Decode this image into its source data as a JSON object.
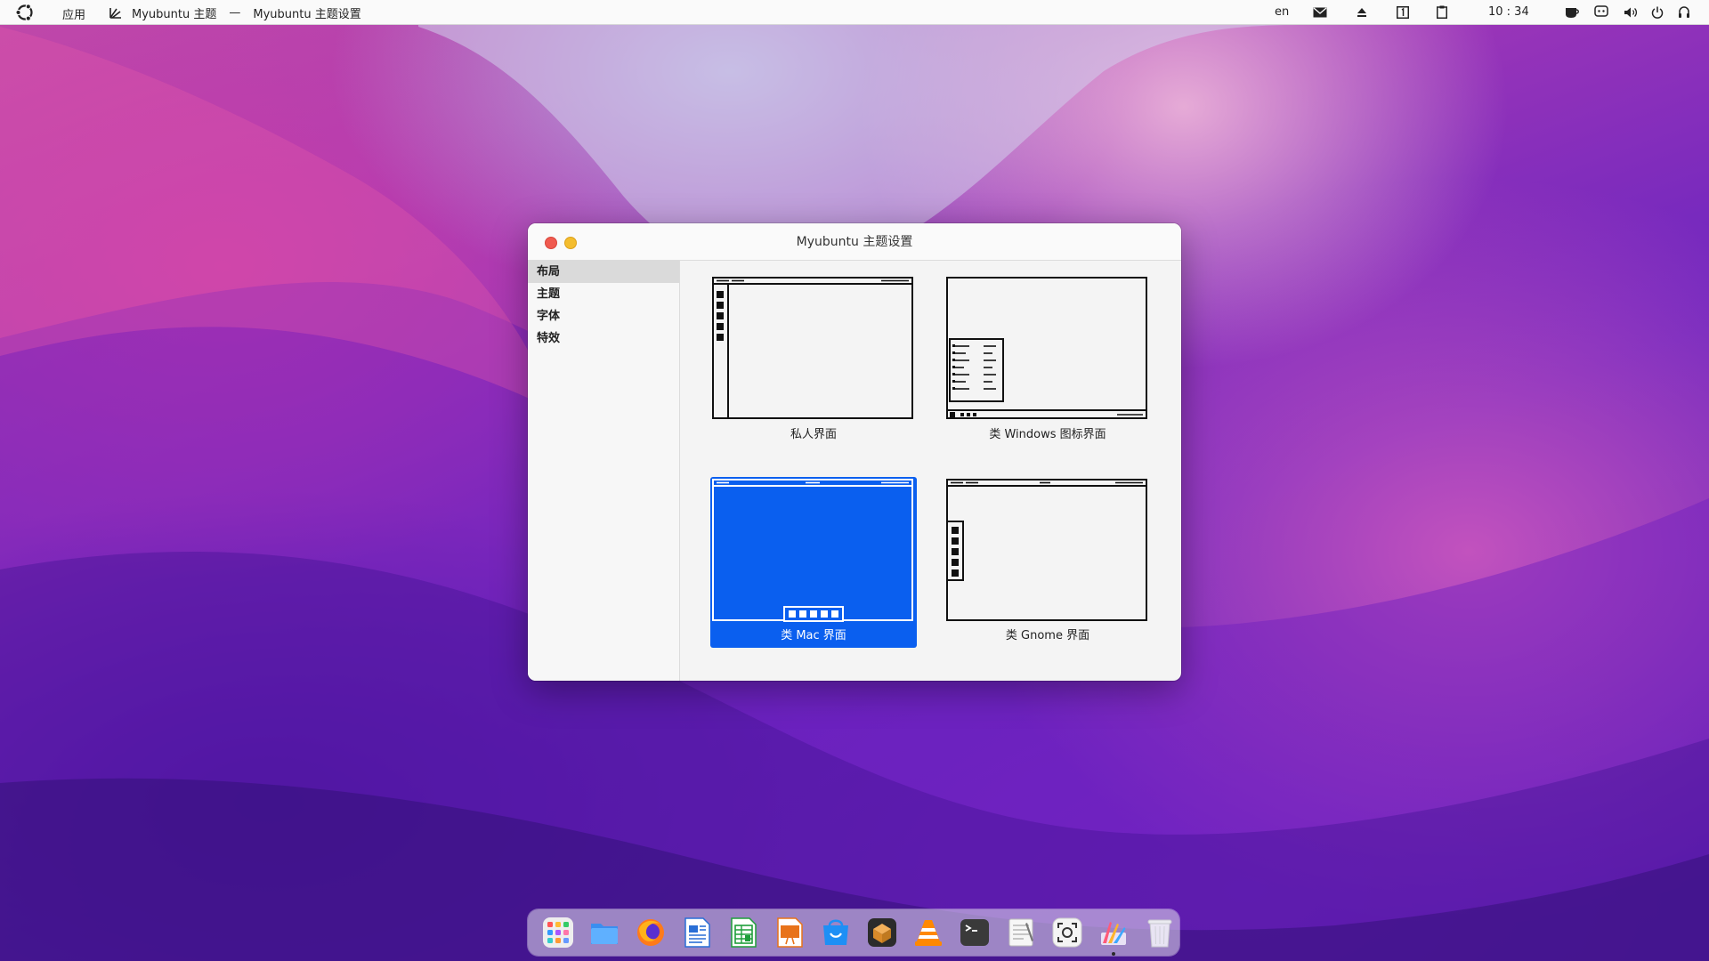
{
  "topbar": {
    "apps_label": "应用",
    "app_name": "Myubuntu 主题",
    "separator": "—",
    "window_name": "Myubuntu 主题设置",
    "input_method": "en",
    "clock": "10 : 34"
  },
  "window": {
    "title": "Myubuntu 主题设置"
  },
  "sidebar": {
    "items": [
      {
        "label": "布局",
        "active": true
      },
      {
        "label": "主题",
        "active": false
      },
      {
        "label": "字体",
        "active": false
      },
      {
        "label": "特效",
        "active": false
      }
    ]
  },
  "layouts": [
    {
      "label": "私人界面",
      "selected": false
    },
    {
      "label": "类 Windows 图标界面",
      "selected": false
    },
    {
      "label": "类 Mac 界面",
      "selected": true
    },
    {
      "label": "类 Gnome 界面",
      "selected": false
    }
  ],
  "dock": {
    "apps": [
      "launcher-icon",
      "files-icon",
      "firefox-icon",
      "writer-icon",
      "calc-icon",
      "impress-icon",
      "app-store-icon",
      "archive-icon",
      "vlc-icon",
      "terminal-icon",
      "text-editor-icon",
      "screenshot-icon",
      "theme-settings-icon",
      "trash-icon"
    ]
  },
  "colors": {
    "accent": "#0a5fef",
    "close": "#f05a4f",
    "minimize": "#f4bd2e"
  }
}
